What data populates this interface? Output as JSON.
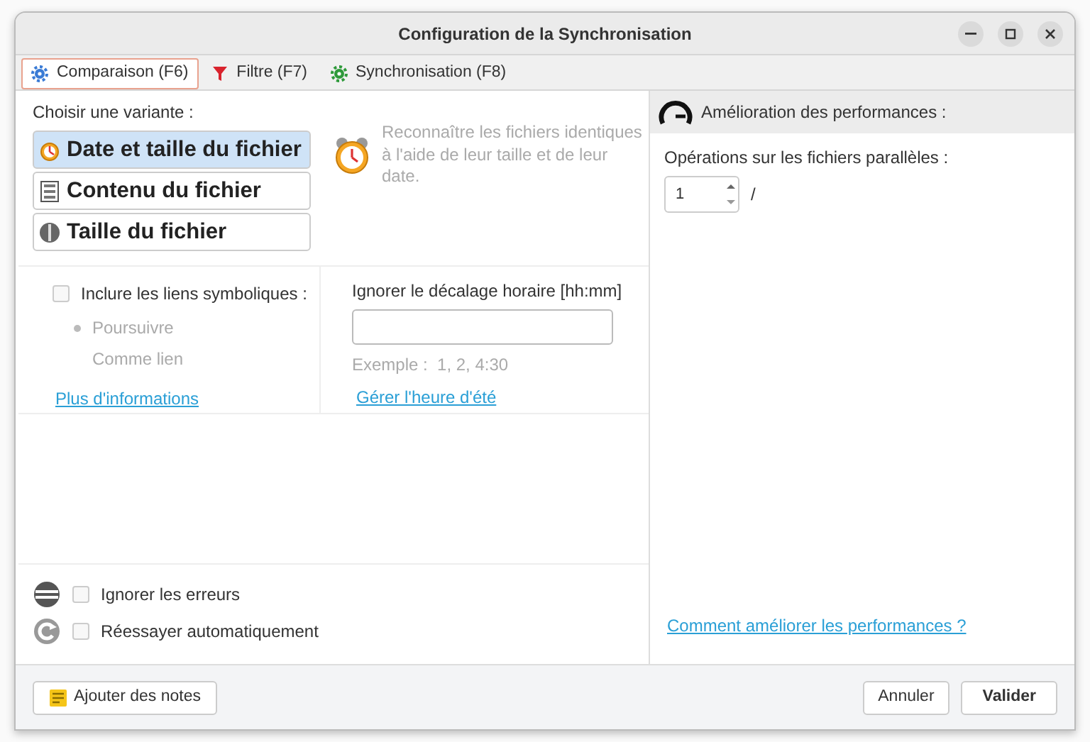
{
  "window": {
    "title": "Configuration de la Synchronisation"
  },
  "tabs": [
    {
      "label": "Comparaison (F6)",
      "selected": true,
      "kind": "compare"
    },
    {
      "label": "Filtre (F7)",
      "selected": false,
      "kind": "filter"
    },
    {
      "label": "Synchronisation (F8)",
      "selected": false,
      "kind": "sync"
    }
  ],
  "variant_heading": "Choisir une variante :",
  "variants": [
    {
      "label": "Date et taille du fichier",
      "selected": true,
      "kind": "clock"
    },
    {
      "label": "Contenu du fichier",
      "selected": false,
      "kind": "binary"
    },
    {
      "label": "Taille du fichier",
      "selected": false,
      "kind": "size"
    }
  ],
  "description": "Reconnaître les fichiers identiques à l'aide de leur taille et de leur date.",
  "symlinks": {
    "label": "Inclure les liens symboliques :",
    "checked": false,
    "options": [
      {
        "label": "Poursuivre",
        "selected": true
      },
      {
        "label": "Comme lien",
        "selected": false
      }
    ],
    "link": "Plus d'informations"
  },
  "time_shift": {
    "label": "Ignorer le décalage horaire [hh:mm]",
    "example": "Exemple :  1, 2, 4:30",
    "link": "Gérer l'heure d'été"
  },
  "error_options": [
    {
      "label": "Ignorer les erreurs",
      "checked": false,
      "kind": "ignore"
    },
    {
      "label": "Réessayer automatiquement",
      "checked": false,
      "kind": "retry"
    }
  ],
  "performance": {
    "heading": "Amélioration des performances :",
    "label": "Opérations sur les fichiers parallèles :",
    "value": "1",
    "suffix": "/",
    "link": "Comment améliorer les performances ?"
  },
  "footer": {
    "notes_button": "Ajouter des notes",
    "cancel_button": "Annuler",
    "ok_button": "Valider"
  }
}
